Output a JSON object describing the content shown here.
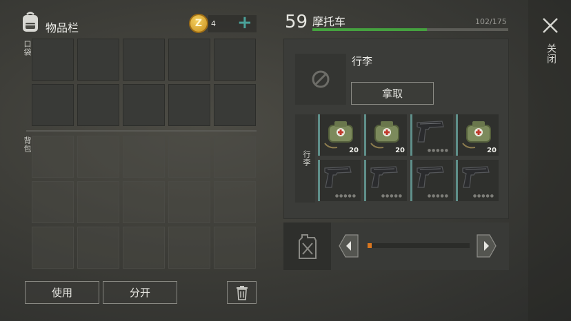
{
  "inventory": {
    "title": "物品栏",
    "currency": {
      "amount": "4",
      "coin_symbol": "Z",
      "add_symbol": "+"
    },
    "sections": {
      "pocket": "口袋",
      "backpack": "背包"
    },
    "buttons": {
      "use": "使用",
      "split": "分开"
    }
  },
  "vehicle": {
    "level": "59",
    "name": "摩托车",
    "capacity_text": "102/175",
    "capacity_fraction": 0.583,
    "trunk_title": "行李",
    "take_button": "拿取",
    "trunk_label": "行李",
    "items": [
      {
        "icon": "medkit-bag-icon",
        "qty": "20"
      },
      {
        "icon": "medkit-bag-icon",
        "qty": "20"
      },
      {
        "icon": "pistol-icon",
        "qty": ""
      },
      {
        "icon": "medkit-bag-icon",
        "qty": "20"
      },
      {
        "icon": "pistol-icon",
        "qty": ""
      },
      {
        "icon": "pistol-icon",
        "qty": ""
      },
      {
        "icon": "pistol-icon",
        "qty": ""
      },
      {
        "icon": "pistol-icon",
        "qty": ""
      }
    ],
    "fuel_fraction": 0.04
  },
  "close_label": "关闭",
  "colors": {
    "accent": "#4aa29a",
    "capacity_bar": "#45a13f",
    "fuel_bar": "#d9761f"
  }
}
